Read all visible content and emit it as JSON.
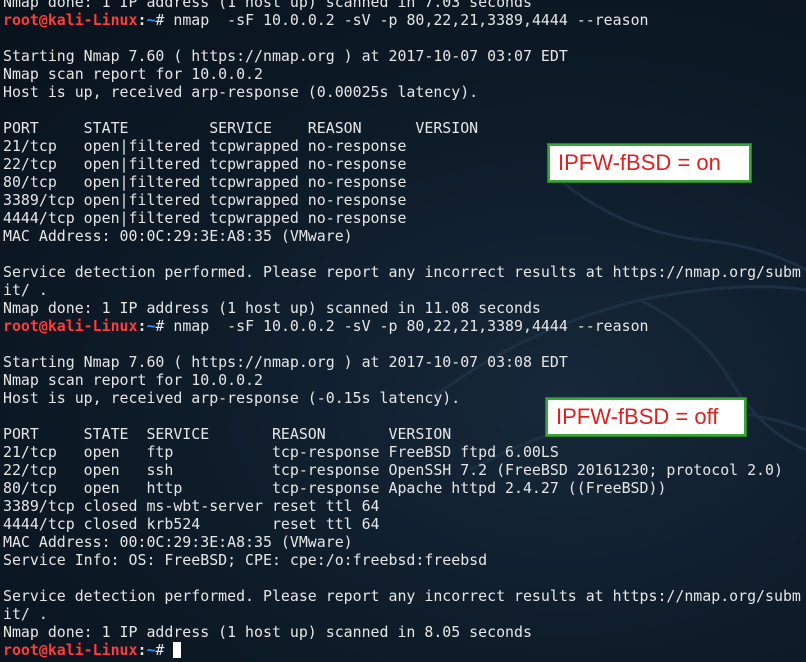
{
  "prompt": {
    "user_host": "root@kali-Linux",
    "sep": ":",
    "path": "~",
    "hash": "# "
  },
  "lines": [
    {
      "type": "text",
      "text": "Nmap done: 1 IP address (1 host up) scanned in 7.03 seconds"
    },
    {
      "type": "prompt",
      "cmd": "nmap  -sF 10.0.0.2 -sV -p 80,22,21,3389,4444 --reason"
    },
    {
      "type": "text",
      "text": ""
    },
    {
      "type": "text",
      "text": "Starting Nmap 7.60 ( https://nmap.org ) at 2017-10-07 03:07 EDT"
    },
    {
      "type": "text",
      "text": "Nmap scan report for 10.0.0.2"
    },
    {
      "type": "text",
      "text": "Host is up, received arp-response (0.00025s latency)."
    },
    {
      "type": "text",
      "text": ""
    },
    {
      "type": "text",
      "text": "PORT     STATE         SERVICE    REASON      VERSION"
    },
    {
      "type": "text",
      "text": "21/tcp   open|filtered tcpwrapped no-response"
    },
    {
      "type": "text",
      "text": "22/tcp   open|filtered tcpwrapped no-response"
    },
    {
      "type": "text",
      "text": "80/tcp   open|filtered tcpwrapped no-response"
    },
    {
      "type": "text",
      "text": "3389/tcp open|filtered tcpwrapped no-response"
    },
    {
      "type": "text",
      "text": "4444/tcp open|filtered tcpwrapped no-response"
    },
    {
      "type": "text",
      "text": "MAC Address: 00:0C:29:3E:A8:35 (VMware)"
    },
    {
      "type": "text",
      "text": ""
    },
    {
      "type": "text",
      "text": "Service detection performed. Please report any incorrect results at https://nmap.org/subm"
    },
    {
      "type": "text",
      "text": "it/ ."
    },
    {
      "type": "text",
      "text": "Nmap done: 1 IP address (1 host up) scanned in 11.08 seconds"
    },
    {
      "type": "prompt",
      "cmd": "nmap  -sF 10.0.0.2 -sV -p 80,22,21,3389,4444 --reason"
    },
    {
      "type": "text",
      "text": ""
    },
    {
      "type": "text",
      "text": "Starting Nmap 7.60 ( https://nmap.org ) at 2017-10-07 03:08 EDT"
    },
    {
      "type": "text",
      "text": "Nmap scan report for 10.0.0.2"
    },
    {
      "type": "text",
      "text": "Host is up, received arp-response (-0.15s latency)."
    },
    {
      "type": "text",
      "text": ""
    },
    {
      "type": "text",
      "text": "PORT     STATE  SERVICE       REASON       VERSION"
    },
    {
      "type": "text",
      "text": "21/tcp   open   ftp           tcp-response FreeBSD ftpd 6.00LS"
    },
    {
      "type": "text",
      "text": "22/tcp   open   ssh           tcp-response OpenSSH 7.2 (FreeBSD 20161230; protocol 2.0)"
    },
    {
      "type": "text",
      "text": "80/tcp   open   http          tcp-response Apache httpd 2.4.27 ((FreeBSD))"
    },
    {
      "type": "text",
      "text": "3389/tcp closed ms-wbt-server reset ttl 64"
    },
    {
      "type": "text",
      "text": "4444/tcp closed krb524        reset ttl 64"
    },
    {
      "type": "text",
      "text": "MAC Address: 00:0C:29:3E:A8:35 (VMware)"
    },
    {
      "type": "text",
      "text": "Service Info: OS: FreeBSD; CPE: cpe:/o:freebsd:freebsd"
    },
    {
      "type": "text",
      "text": ""
    },
    {
      "type": "text",
      "text": "Service detection performed. Please report any incorrect results at https://nmap.org/subm"
    },
    {
      "type": "text",
      "text": "it/ ."
    },
    {
      "type": "text",
      "text": "Nmap done: 1 IP address (1 host up) scanned in 8.05 seconds"
    },
    {
      "type": "prompt",
      "cmd": "",
      "cursor": true
    }
  ],
  "annotations": {
    "on": "IPFW-fBSD = on",
    "off": "IPFW-fBSD = off"
  },
  "colors": {
    "background": "#0d1a27",
    "text": "#e6e6e6",
    "prompt_user": "#ff3c3c",
    "prompt_path": "#3c8cff",
    "annotation_text": "#e02020",
    "annotation_border": "#38a838"
  }
}
